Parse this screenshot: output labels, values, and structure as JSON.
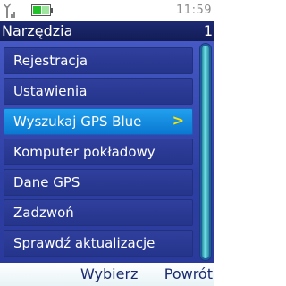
{
  "status": {
    "time": "11:59",
    "signal_icon": "signal-antenna-icon",
    "battery_icon": "battery-icon",
    "battery_color": "#22c32a"
  },
  "header": {
    "title": "Narzędzia",
    "page_number": "1"
  },
  "menu": {
    "items": [
      {
        "label": "Rejestracja"
      },
      {
        "label": "Ustawienia"
      },
      {
        "label": "Wyszukaj GPS Blue",
        "selected": true,
        "indicator": ">"
      },
      {
        "label": "Komputer pokładowy"
      },
      {
        "label": "Dane GPS"
      },
      {
        "label": "Zadzwoń"
      },
      {
        "label": "Sprawdź aktualizacje"
      }
    ]
  },
  "softkeys": {
    "middle": "Wybierz",
    "right": "Powrót"
  },
  "colors": {
    "title_bar": "#1d2a73",
    "list_background": "#3a4db8",
    "selected_item": "#1a90e6",
    "indicator": "#ffe400",
    "scrollbar": "#6fe0ea"
  }
}
